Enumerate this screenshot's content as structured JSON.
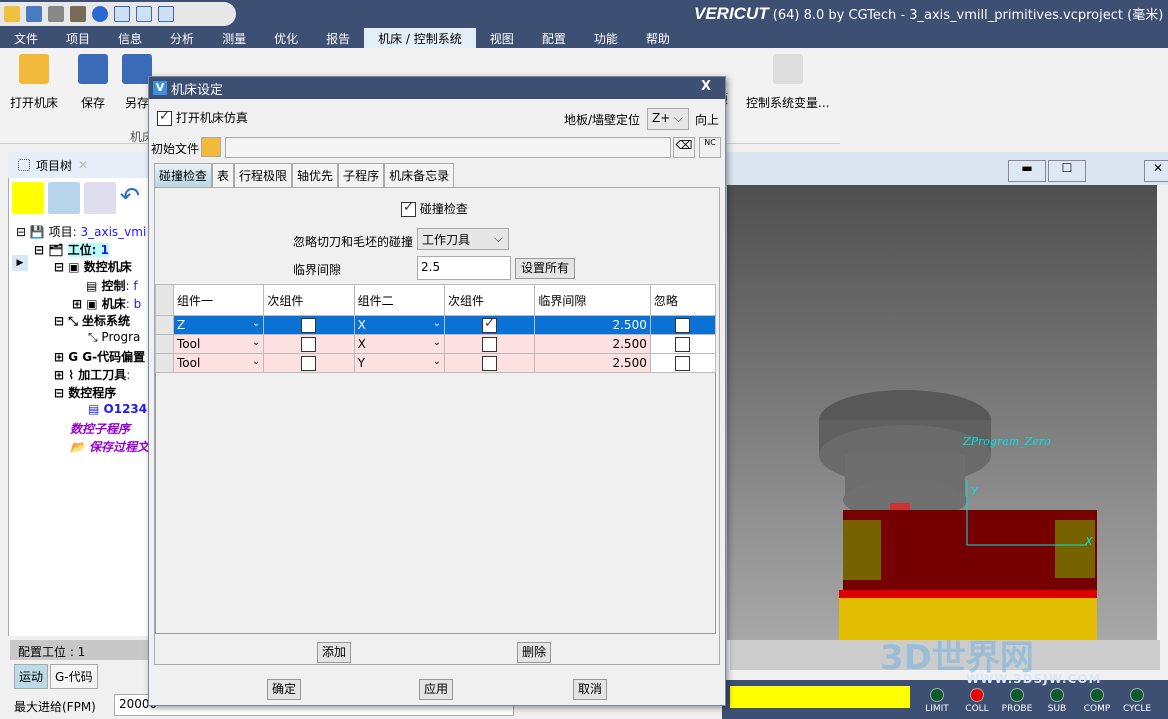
{
  "app": {
    "brand": "VERICUT",
    "title_rest": "(64)  8.0 by CGTech - 3_axis_vmill_primitives.vcproject (毫米)"
  },
  "menu": [
    "文件",
    "项目",
    "信息",
    "分析",
    "测量",
    "优化",
    "报告",
    "机床 / 控制系统",
    "视图",
    "配置",
    "功能",
    "帮助"
  ],
  "menu_active": "机床 / 控制系统",
  "ribbon": {
    "open_machine": "打开机床",
    "save": "保存",
    "save_as": "另存",
    "group_label": "机床",
    "partial_item": "项",
    "control_vars": "控制系统变量..."
  },
  "project_tree": {
    "tab_label": "项目树",
    "items": [
      {
        "label": "项目",
        "value": ": 3_axis_vmi"
      },
      {
        "label": "工位",
        "value": ": 1"
      },
      {
        "label": "数控机床",
        "value": ""
      },
      {
        "label": "控制",
        "value": ": f"
      },
      {
        "label": "机床",
        "value": ": b"
      },
      {
        "label": "坐标系统",
        "value": ""
      },
      {
        "label": "Progra",
        "value": ""
      },
      {
        "label": "G-代码偏置",
        "value": ""
      },
      {
        "label": "加工刀具",
        "value": ":"
      },
      {
        "label": "数控程序",
        "value": ""
      },
      {
        "label": "O1234.",
        "value": ""
      },
      {
        "label": "数控子程序",
        "value": ""
      },
      {
        "label": "保存过程文",
        "value": ""
      }
    ]
  },
  "config_panel": {
    "title": "配置工位 : 1",
    "tabs": [
      "运动",
      "G-代码"
    ],
    "max_feed_label": "最大进给(FPM)",
    "max_feed_value": "20000"
  },
  "viewport": {
    "csys_label": "ZProgram_Zero",
    "y_label": "Y",
    "x_label": "X"
  },
  "status_leds": [
    "LIMIT",
    "COLL",
    "PROBE",
    "SUB",
    "COMP",
    "CYCLE"
  ],
  "watermark": {
    "text": "3D世界网",
    "url": "WWW.3DSJW.COM"
  },
  "dialog": {
    "title": "机床设定",
    "open_sim_label": "打开机床仿真",
    "open_sim_checked": true,
    "floor_label": "地板/墙壁定位",
    "floor_value": "Z+",
    "up_label": "向上",
    "init_file_label": "初始文件",
    "init_file_value": "",
    "tabs": [
      "碰撞检查",
      "表",
      "行程极限",
      "轴优先",
      "子程序",
      "机床备忘录"
    ],
    "active_tab": "碰撞检查",
    "collision_check_label": "碰撞检查",
    "collision_check_checked": true,
    "ignore_label": "忽略切刀和毛坯的碰撞",
    "ignore_value": "工作刀具",
    "clearance_label": "临界间隙",
    "clearance_value": "2.5",
    "set_all": "设置所有",
    "columns": [
      "组件一",
      "次组件",
      "组件二",
      "次组件",
      "临界间隙",
      "忽略"
    ],
    "rows": [
      {
        "comp1": "Z",
        "sub1": false,
        "comp2": "X",
        "sub2": true,
        "clearance": "2.500",
        "ignore": false,
        "selected": true
      },
      {
        "comp1": "Tool",
        "sub1": false,
        "comp2": "X",
        "sub2": false,
        "clearance": "2.500",
        "ignore": false,
        "selected": false
      },
      {
        "comp1": "Tool",
        "sub1": false,
        "comp2": "Y",
        "sub2": false,
        "clearance": "2.500",
        "ignore": false,
        "selected": false
      }
    ],
    "add": "添加",
    "delete": "删除",
    "ok": "确定",
    "apply": "应用",
    "cancel": "取消"
  }
}
